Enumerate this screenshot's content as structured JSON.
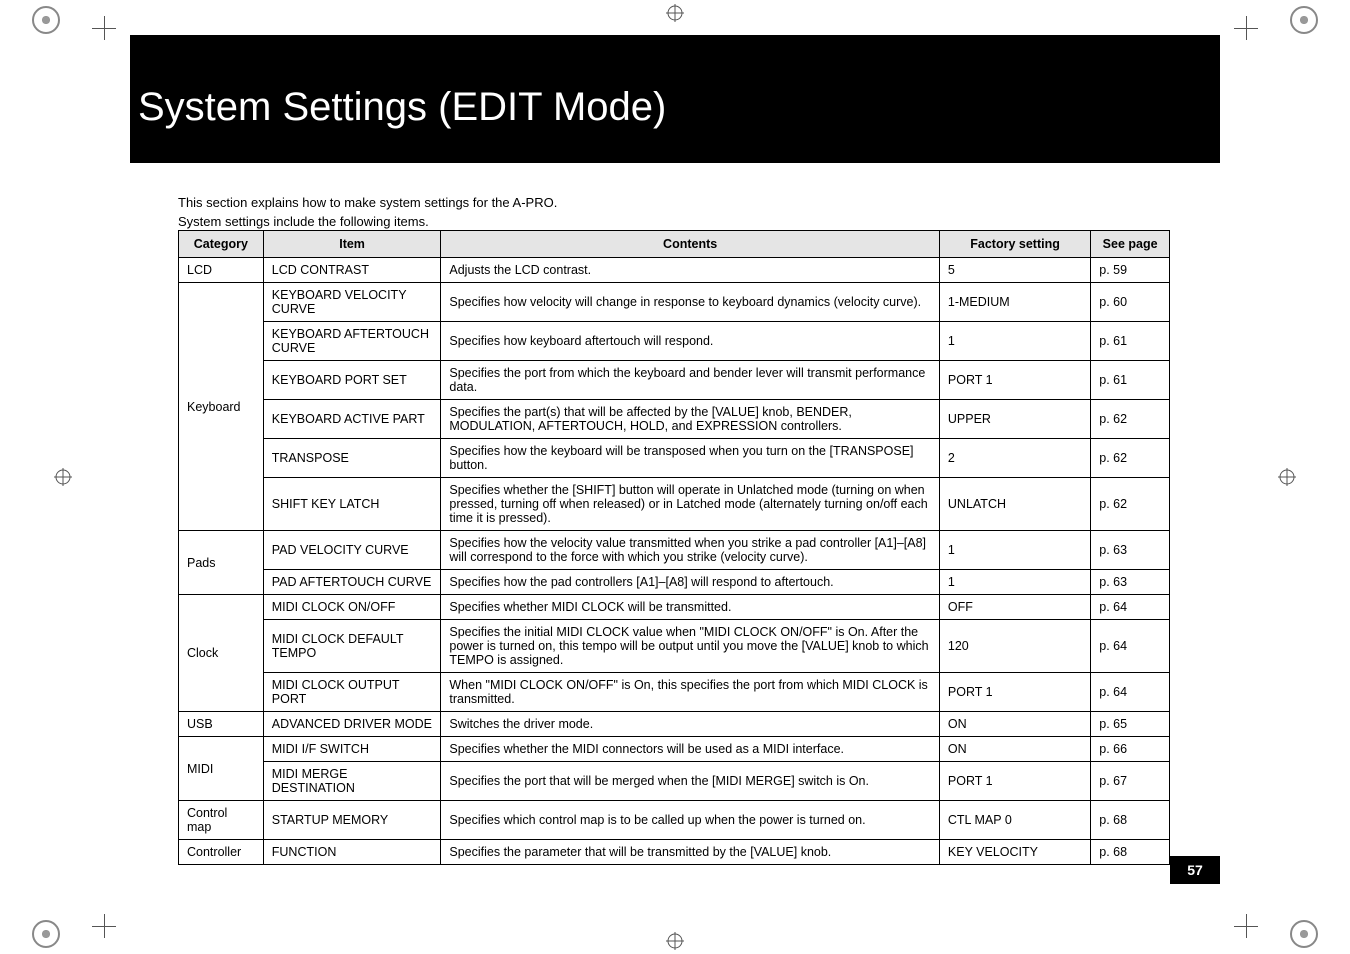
{
  "top_fragment": "",
  "title": "System Settings (EDIT Mode)",
  "intro_line1": "This section explains how to make system settings for the A-PRO.",
  "intro_line2": "System settings include the following items.",
  "page_number": "57",
  "headers": {
    "category": "Category",
    "item": "Item",
    "contents": "Contents",
    "factory": "Factory setting",
    "seepage": "See page"
  },
  "rows": [
    {
      "category": "LCD",
      "rowspan": 1,
      "item": "LCD CONTRAST",
      "contents": "Adjusts the LCD contrast.",
      "factory": "5",
      "page": "p. 59"
    },
    {
      "category": "Keyboard",
      "rowspan": 6,
      "item": "KEYBOARD VELOCITY CURVE",
      "contents": "Specifies how velocity will change in response to keyboard dynamics (velocity curve).",
      "factory": "1-MEDIUM",
      "page": "p. 60"
    },
    {
      "item": "KEYBOARD AFTERTOUCH CURVE",
      "contents": "Specifies how keyboard aftertouch will respond.",
      "factory": "1",
      "page": "p. 61"
    },
    {
      "item": "KEYBOARD PORT SET",
      "contents": "Specifies the port from which the keyboard and bender lever will transmit performance data.",
      "factory": "PORT 1",
      "page": "p. 61"
    },
    {
      "item": "KEYBOARD ACTIVE PART",
      "contents": "Specifies the part(s) that will be affected by the [VALUE] knob, BENDER, MODULATION, AFTERTOUCH, HOLD, and EXPRESSION controllers.",
      "factory": "UPPER",
      "page": "p. 62"
    },
    {
      "item": "TRANSPOSE",
      "contents": "Specifies how the keyboard will be transposed when you turn on the [TRANSPOSE] button.",
      "factory": "2",
      "page": "p. 62"
    },
    {
      "item": "SHIFT KEY LATCH",
      "contents": "Specifies whether the [SHIFT] button will operate in Unlatched mode (turning on when pressed, turning off when released) or in Latched mode (alternately turning on/off each time it is pressed).",
      "factory": "UNLATCH",
      "page": "p. 62"
    },
    {
      "category": "Pads",
      "rowspan": 2,
      "item": "PAD VELOCITY CURVE",
      "contents": "Specifies how the velocity value transmitted when you strike a pad controller [A1]–[A8] will correspond to the force with which you strike (velocity curve).",
      "factory": "1",
      "page": "p. 63"
    },
    {
      "item": "PAD AFTERTOUCH CURVE",
      "contents": "Specifies how the pad controllers [A1]–[A8] will respond to aftertouch.",
      "factory": "1",
      "page": "p. 63"
    },
    {
      "category": "Clock",
      "rowspan": 3,
      "item": "MIDI CLOCK ON/OFF",
      "contents": "Specifies whether MIDI CLOCK will be transmitted.",
      "factory": "OFF",
      "page": "p. 64"
    },
    {
      "item": "MIDI CLOCK DEFAULT TEMPO",
      "contents": "Specifies the initial MIDI CLOCK value when \"MIDI CLOCK ON/OFF\" is On. After the power is turned on, this tempo will be output until you move the [VALUE] knob to which TEMPO is assigned.",
      "factory": "120",
      "page": "p. 64"
    },
    {
      "item": "MIDI CLOCK OUTPUT PORT",
      "contents": "When \"MIDI CLOCK ON/OFF\" is On, this specifies the port from which MIDI CLOCK is transmitted.",
      "factory": "PORT 1",
      "page": "p. 64"
    },
    {
      "category": "USB",
      "rowspan": 1,
      "item": "ADVANCED DRIVER MODE",
      "contents": "Switches the driver mode.",
      "factory": "ON",
      "page": "p. 65"
    },
    {
      "category": "MIDI",
      "rowspan": 2,
      "item": "MIDI I/F SWITCH",
      "contents": "Specifies whether the MIDI connectors will be used as a MIDI interface.",
      "factory": "ON",
      "page": "p. 66"
    },
    {
      "item": "MIDI MERGE DESTINATION",
      "contents": "Specifies the port that will be merged when the [MIDI MERGE] switch is On.",
      "factory": "PORT 1",
      "page": "p. 67"
    },
    {
      "category": "Control map",
      "rowspan": 1,
      "item": "STARTUP MEMORY",
      "contents": "Specifies which control map is to be called up when the power is turned on.",
      "factory": "CTL MAP 0",
      "page": "p. 68"
    },
    {
      "category": "Controller",
      "rowspan": 1,
      "item": "FUNCTION",
      "contents": "Specifies the parameter that will be transmitted by the [VALUE] knob.",
      "factory": "KEY VELOCITY",
      "page": "p. 68"
    }
  ]
}
